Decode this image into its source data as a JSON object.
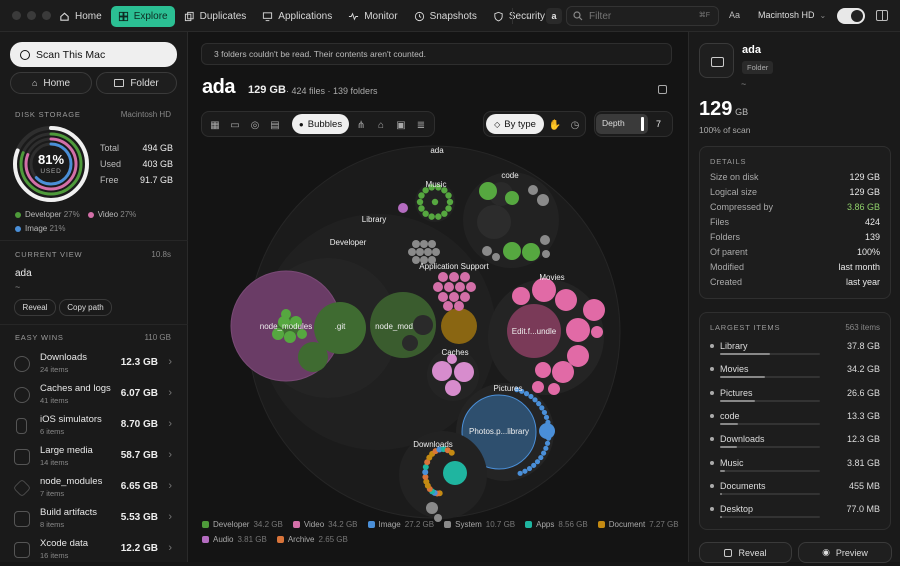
{
  "nav": {
    "tabs": [
      {
        "label": "Home",
        "icon": "home-icon"
      },
      {
        "label": "Explore",
        "icon": "grid-icon",
        "active": true
      },
      {
        "label": "Duplicates",
        "icon": "copy-icon"
      },
      {
        "label": "Applications",
        "icon": "monitor-icon"
      },
      {
        "label": "Monitor",
        "icon": "pulse-icon"
      },
      {
        "label": "Snapshots",
        "icon": "clock-icon"
      },
      {
        "label": "Security",
        "icon": "shield-icon"
      }
    ],
    "nav_letter": "a",
    "search_placeholder": "Filter",
    "search_kbd": "⌘F",
    "font_toggle": "Aa",
    "volume": "Macintosh HD"
  },
  "left": {
    "scan_label": "Scan This Mac",
    "home_label": "Home",
    "folder_label": "Folder",
    "disk_title": "DISK STORAGE",
    "disk_volume": "Macintosh HD",
    "used_pct": "81%",
    "used_label": "USED",
    "used_fraction": 0.81,
    "stats": [
      {
        "k": "Total",
        "v": "494 GB"
      },
      {
        "k": "Used",
        "v": "403 GB"
      },
      {
        "k": "Free",
        "v": "91.7 GB"
      }
    ],
    "legend": [
      {
        "label": "Developer",
        "pct": "27%",
        "color": "#4e9a3a"
      },
      {
        "label": "Video",
        "pct": "27%",
        "color": "#d36fa8"
      },
      {
        "label": "Image",
        "pct": "21%",
        "color": "#4a8fd8"
      }
    ],
    "current_view_title": "CURRENT VIEW",
    "current_view_time": "10.8s",
    "current_name": "ada",
    "current_path": "~",
    "reveal_label": "Reveal",
    "copy_path_label": "Copy path",
    "easy_wins_title": "EASY WINS",
    "easy_wins_total": "110 GB",
    "easy_wins": [
      {
        "title": "Downloads",
        "sub": "24 items",
        "value": "12.3 GB",
        "icon": "download-icon"
      },
      {
        "title": "Caches and logs",
        "sub": "41 items",
        "value": "6.07 GB",
        "icon": "clock-icon"
      },
      {
        "title": "iOS simulators",
        "sub": "6 items",
        "value": "8.70 GB",
        "icon": "phone-icon"
      },
      {
        "title": "Large media",
        "sub": "14 items",
        "value": "58.7 GB",
        "icon": "media-icon"
      },
      {
        "title": "node_modules",
        "sub": "7 items",
        "value": "6.65 GB",
        "icon": "package-icon"
      },
      {
        "title": "Build artifacts",
        "sub": "8 items",
        "value": "5.53 GB",
        "icon": "build-icon"
      },
      {
        "title": "Xcode data",
        "sub": "16 items",
        "value": "12.2 GB",
        "icon": "hammer-icon"
      }
    ]
  },
  "center": {
    "warning": "3 folders couldn't be read. Their contents aren't counted.",
    "title": "ada",
    "size": "129 GB",
    "files": "424 files",
    "folders": "139 folders",
    "bubbles_label": "Bubbles",
    "by_type_label": "By type",
    "depth_label": "Depth",
    "depth_value": "7",
    "bubble_labels": {
      "root": "ada",
      "music": "Music",
      "code": "code",
      "library": "Library",
      "developer": "Developer",
      "app_support": "Application Support",
      "movies": "Movies",
      "node_modules_short": "node_modules",
      "git": ".git",
      "node_mod": "node_mod",
      "edit_bundle": "Edit.f...undle",
      "caches": "Caches",
      "pictures": "Pictures",
      "photos_library": "Photos.p...library",
      "downloads": "Downloads"
    },
    "type_legend": [
      {
        "label": "Developer",
        "value": "34.2 GB",
        "color": "#4e9a3a"
      },
      {
        "label": "Video",
        "value": "34.2 GB",
        "color": "#d36fa8"
      },
      {
        "label": "Image",
        "value": "27.2 GB",
        "color": "#4a8fd8"
      },
      {
        "label": "System",
        "value": "10.7 GB",
        "color": "#8a8a8a"
      },
      {
        "label": "Apps",
        "value": "8.56 GB",
        "color": "#1fb5a0"
      },
      {
        "label": "Document",
        "value": "7.27 GB",
        "color": "#c48a12"
      },
      {
        "label": "Audio",
        "value": "3.81 GB",
        "color": "#b46cc0"
      },
      {
        "label": "Archive",
        "value": "2.65 GB",
        "color": "#d9743a"
      }
    ]
  },
  "right": {
    "name": "ada",
    "badge": "Folder",
    "path": "~",
    "size_num": "129",
    "size_unit": "GB",
    "pct_scan": "100% of scan",
    "details_title": "DETAILS",
    "details": [
      {
        "k": "Size on disk",
        "v": "129 GB"
      },
      {
        "k": "Logical size",
        "v": "129 GB"
      },
      {
        "k": "Compressed by",
        "v": "3.86 GB",
        "accent": true
      },
      {
        "k": "Files",
        "v": "424"
      },
      {
        "k": "Folders",
        "v": "139"
      },
      {
        "k": "Of parent",
        "v": "100%"
      },
      {
        "k": "Modified",
        "v": "last month"
      },
      {
        "k": "Created",
        "v": "last year"
      }
    ],
    "largest_title": "LARGEST ITEMS",
    "largest_count": "563 items",
    "largest": [
      {
        "name": "Library",
        "value": "37.8 GB",
        "frac": 1.0
      },
      {
        "name": "Movies",
        "value": "34.2 GB",
        "frac": 0.9
      },
      {
        "name": "Pictures",
        "value": "26.6 GB",
        "frac": 0.7
      },
      {
        "name": "code",
        "value": "13.3 GB",
        "frac": 0.35
      },
      {
        "name": "Downloads",
        "value": "12.3 GB",
        "frac": 0.33
      },
      {
        "name": "Music",
        "value": "3.81 GB",
        "frac": 0.1
      },
      {
        "name": "Documents",
        "value": "455 MB",
        "frac": 0.02
      },
      {
        "name": "Desktop",
        "value": "77.0 MB",
        "frac": 0.01
      }
    ],
    "reveal_label": "Reveal",
    "preview_label": "Preview",
    "accent": "#2bbf93"
  }
}
